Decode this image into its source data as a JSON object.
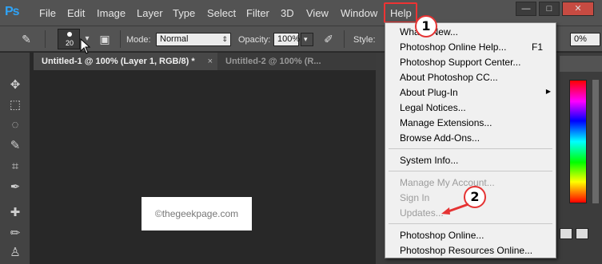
{
  "app": {
    "logo": "Ps"
  },
  "menu": {
    "items": [
      "File",
      "Edit",
      "Image",
      "Layer",
      "Type",
      "Select",
      "Filter",
      "3D",
      "View",
      "Window",
      "Help"
    ]
  },
  "window_controls": {
    "minimize": "—",
    "maximize": "□",
    "close": "✕"
  },
  "options": {
    "brush_size": "20",
    "mode_label": "Mode:",
    "mode_value": "Normal",
    "opacity_label": "Opacity:",
    "opacity_value": "100%",
    "style_label": "Style:",
    "right_value": "0%"
  },
  "tabs": [
    {
      "label": "Untitled-1 @ 100% (Layer 1, RGB/8) *",
      "close": "×"
    },
    {
      "label": "Untitled-2 @ 100% (R...",
      "close": ""
    }
  ],
  "canvas": {
    "watermark": "©thegeekpage.com"
  },
  "help_menu": {
    "items": [
      {
        "label": "What's New...",
        "shortcut": ""
      },
      {
        "label": "Photoshop Online Help...",
        "shortcut": "F1"
      },
      {
        "label": "Photoshop Support Center...",
        "shortcut": ""
      },
      {
        "label": "About Photoshop CC...",
        "shortcut": ""
      },
      {
        "label": "About Plug-In",
        "shortcut": ""
      },
      {
        "label": "Legal Notices...",
        "shortcut": ""
      },
      {
        "label": "Manage Extensions...",
        "shortcut": ""
      },
      {
        "label": "Browse Add-Ons...",
        "shortcut": ""
      },
      {
        "label": "System Info...",
        "shortcut": ""
      },
      {
        "label": "Manage My Account...",
        "shortcut": ""
      },
      {
        "label": "Sign In",
        "shortcut": ""
      },
      {
        "label": "Updates...",
        "shortcut": ""
      },
      {
        "label": "Photoshop Online...",
        "shortcut": ""
      },
      {
        "label": "Photoshop Resources Online...",
        "shortcut": ""
      }
    ]
  },
  "annotations": {
    "step1": "1",
    "step2": "2"
  },
  "colors": {
    "highlight": "#e53333",
    "ps_blue": "#2fa3f6"
  }
}
